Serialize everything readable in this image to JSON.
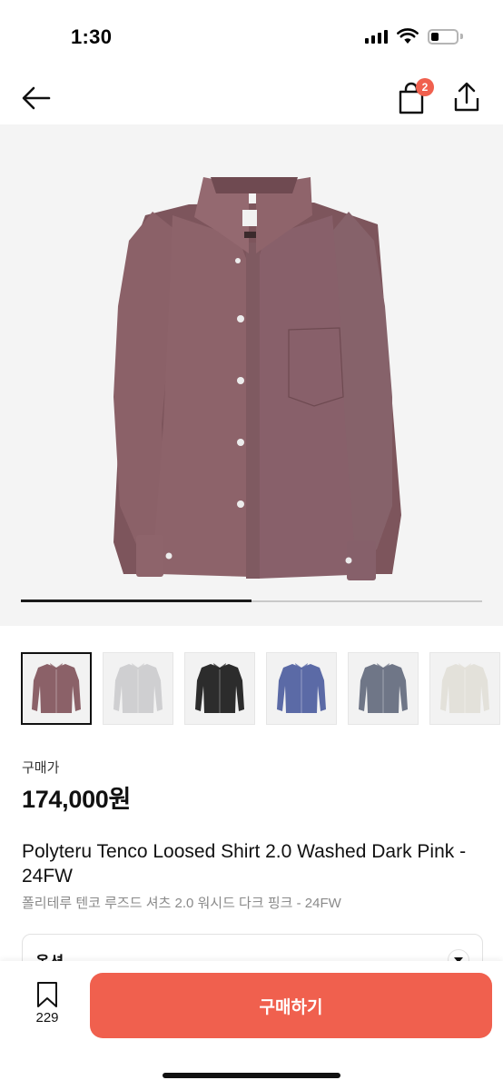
{
  "status_bar": {
    "time": "1:30"
  },
  "header": {
    "cart_count": "2"
  },
  "gallery": {
    "progress_fraction": 0.5,
    "thumbnail_colors": [
      "#8b6168",
      "#cfcfd1",
      "#2c2c2c",
      "#5b6aa6",
      "#6f7687",
      "#e3e1da"
    ],
    "selected_index": 0
  },
  "price": {
    "label": "구매가",
    "value": "174,000원"
  },
  "product": {
    "title_en": "Polyteru Tenco Loosed Shirt 2.0 Washed Dark Pink - 24FW",
    "title_ko": "폴리테루 텐코 루즈드 셔츠 2.0 워시드 다크 핑크 - 24FW"
  },
  "option": {
    "label": "옵션"
  },
  "bottom_bar": {
    "wishlist_count": "229",
    "buy_label": "구매하기"
  },
  "colors": {
    "accent": "#f0604e",
    "shirt": "#8b6168"
  },
  "icons": [
    "back-arrow-icon",
    "shopping-bag-icon",
    "share-icon",
    "bookmark-icon",
    "chevron-down-icon"
  ]
}
